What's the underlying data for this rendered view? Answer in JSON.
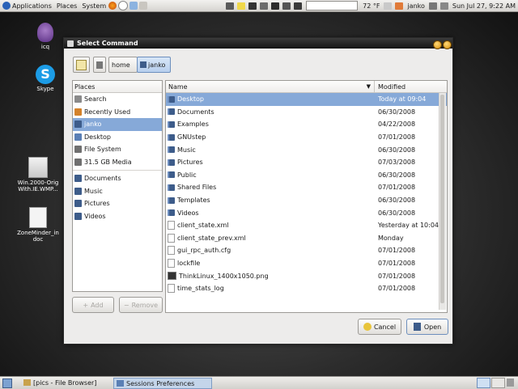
{
  "top_panel": {
    "menus": [
      "Applications",
      "Places",
      "System"
    ],
    "battery": "72 °F",
    "user": "janko",
    "datetime": "Sun Jul 27,  9:22 AM"
  },
  "desktop_icons": [
    {
      "label": "icq"
    },
    {
      "label": "Skype"
    },
    {
      "label": "Win.2000-Orig With.IE.WMP..."
    },
    {
      "label": "ZoneMinder_in doc"
    }
  ],
  "dialog": {
    "title": "Select Command",
    "path": [
      "home",
      "janko"
    ],
    "places_header": "Places",
    "places": [
      {
        "label": "Search",
        "icon": "search-icon"
      },
      {
        "label": "Recently Used",
        "icon": "clock-icon"
      },
      {
        "label": "janko",
        "icon": "home-icon",
        "selected": true
      },
      {
        "label": "Desktop",
        "icon": "desktop-icon"
      },
      {
        "label": "File System",
        "icon": "drive-icon"
      },
      {
        "label": "31.5 GB Media",
        "icon": "drive-icon"
      }
    ],
    "bookmarks": [
      {
        "label": "Documents"
      },
      {
        "label": "Music"
      },
      {
        "label": "Pictures"
      },
      {
        "label": "Videos"
      }
    ],
    "add_label": "Add",
    "remove_label": "Remove",
    "col_name": "Name",
    "col_modified": "Modified",
    "files": [
      {
        "name": "Desktop",
        "modified": "Today at 09:04",
        "type": "folder",
        "selected": true
      },
      {
        "name": "Documents",
        "modified": "06/30/2008",
        "type": "folder"
      },
      {
        "name": "Examples",
        "modified": "04/22/2008",
        "type": "folder"
      },
      {
        "name": "GNUstep",
        "modified": "07/01/2008",
        "type": "folder"
      },
      {
        "name": "Music",
        "modified": "06/30/2008",
        "type": "folder"
      },
      {
        "name": "Pictures",
        "modified": "07/03/2008",
        "type": "folder"
      },
      {
        "name": "Public",
        "modified": "06/30/2008",
        "type": "folder"
      },
      {
        "name": "Shared Files",
        "modified": "07/01/2008",
        "type": "folder"
      },
      {
        "name": "Templates",
        "modified": "06/30/2008",
        "type": "folder"
      },
      {
        "name": "Videos",
        "modified": "06/30/2008",
        "type": "folder"
      },
      {
        "name": "client_state.xml",
        "modified": "Yesterday at 10:04",
        "type": "doc"
      },
      {
        "name": "client_state_prev.xml",
        "modified": "Monday",
        "type": "doc"
      },
      {
        "name": "gui_rpc_auth.cfg",
        "modified": "07/01/2008",
        "type": "doc"
      },
      {
        "name": "lockfile",
        "modified": "07/01/2008",
        "type": "doc"
      },
      {
        "name": "ThinkLinux_1400x1050.png",
        "modified": "07/01/2008",
        "type": "img"
      },
      {
        "name": "time_stats_log",
        "modified": "07/01/2008",
        "type": "doc"
      }
    ],
    "cancel_label": "Cancel",
    "open_label": "Open"
  },
  "bottom_panel": {
    "tasks": [
      "[pics - File Browser]",
      "Sessions Preferences"
    ]
  }
}
